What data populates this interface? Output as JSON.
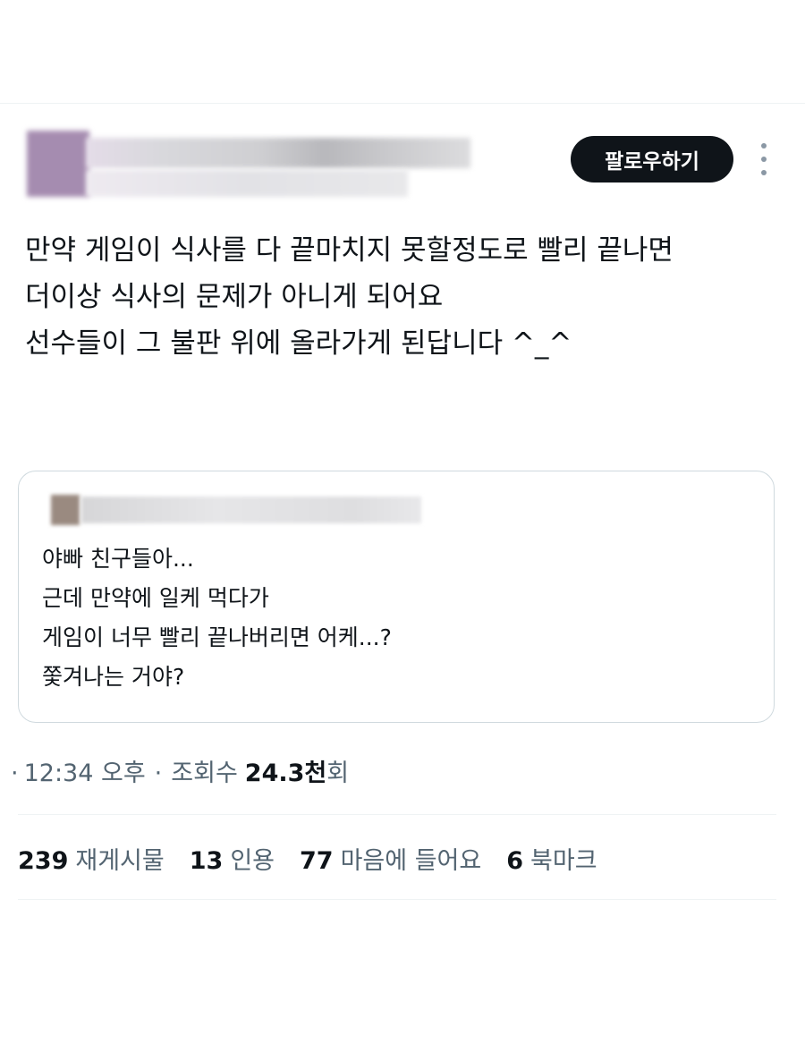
{
  "header": {
    "follow_label": "팔로우하기"
  },
  "tweet": {
    "lines": [
      "만약 게임이 식사를 다 끝마치지 못할정도로 빨리 끝나면",
      "더이상 식사의 문제가 아니게 되어요",
      "선수들이 그 불판 위에 올라가게 된답니다 ^_^"
    ]
  },
  "quote": {
    "lines": [
      "야빠 친구들아...",
      "근데 만약에 일케 먹다가",
      "게임이 너무 빨리 끝나버리면 어케...?",
      "쫓겨나는 거야?"
    ]
  },
  "meta": {
    "time": "12:34 오후",
    "separator": "·",
    "views_label": "조회수",
    "views_number": "24.3천",
    "views_unit": "회"
  },
  "stats": [
    {
      "count": "239",
      "label": "재게시물"
    },
    {
      "count": "13",
      "label": "인용"
    },
    {
      "count": "77",
      "label": "마음에 들어요"
    },
    {
      "count": "6",
      "label": "북마크"
    }
  ],
  "colors": {
    "text": "#0f1419",
    "secondary": "#536471",
    "border": "#cfd9de",
    "button_bg": "#0f1419"
  }
}
